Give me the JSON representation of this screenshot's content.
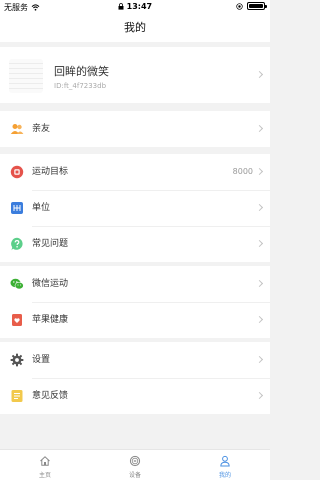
{
  "status_bar": {
    "carrier": "无服务",
    "time": "13:47"
  },
  "nav": {
    "title": "我的"
  },
  "profile": {
    "name": "回眸的微笑",
    "user_id": "ID:ft_4f7233db"
  },
  "groups": [
    {
      "items": [
        {
          "key": "friends",
          "label": "亲友",
          "icon": "people-icon"
        }
      ]
    },
    {
      "items": [
        {
          "key": "goal",
          "label": "运动目标",
          "value": "8000",
          "icon": "target-icon"
        },
        {
          "key": "unit",
          "label": "单位",
          "icon": "unit-icon"
        },
        {
          "key": "faq",
          "label": "常见问题",
          "icon": "question-icon"
        }
      ]
    },
    {
      "items": [
        {
          "key": "wechat",
          "label": "微信运动",
          "icon": "wechat-icon"
        },
        {
          "key": "health",
          "label": "苹果健康",
          "icon": "health-icon"
        }
      ]
    },
    {
      "items": [
        {
          "key": "settings",
          "label": "设置",
          "icon": "gear-icon"
        },
        {
          "key": "feedback",
          "label": "意见反馈",
          "icon": "feedback-icon"
        }
      ]
    }
  ],
  "tabs": [
    {
      "label": "主页",
      "icon": "home-icon"
    },
    {
      "label": "设备",
      "icon": "watch-icon"
    },
    {
      "label": "我的",
      "icon": "person-icon",
      "active": true
    }
  ],
  "colors": {
    "accent": "#4a90e2",
    "friends": "#f5a033",
    "goal": "#e5534b",
    "unit": "#3b7ddd",
    "faq": "#5ccf8a",
    "wechat": "#3cb034",
    "health": "#e85d4a",
    "settings": "#555555",
    "feedback": "#f2c94c"
  }
}
